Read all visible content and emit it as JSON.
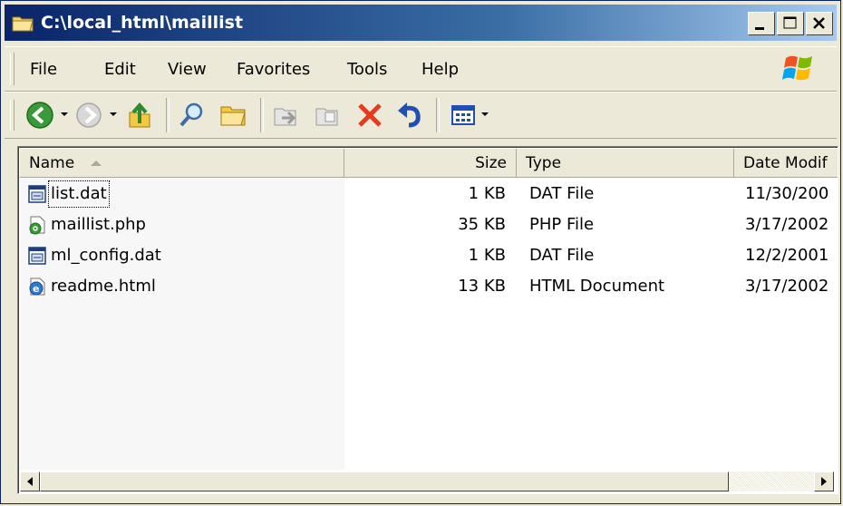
{
  "window": {
    "title": "C:\\local_html\\maillist"
  },
  "menu": [
    "File",
    "Edit",
    "View",
    "Favorites",
    "Tools",
    "Help"
  ],
  "colors": {
    "titlebar_start": "#0a246a",
    "titlebar_end": "#a6caf0",
    "face": "#ece9d8"
  },
  "columns": {
    "name": "Name",
    "size": "Size",
    "type": "Type",
    "date": "Date Modif"
  },
  "files": [
    {
      "name": "list.dat",
      "size": "1 KB",
      "type": "DAT File",
      "date": "11/30/200",
      "icon": "dat-file-icon"
    },
    {
      "name": "maillist.php",
      "size": "35 KB",
      "type": "PHP File",
      "date": "3/17/2002",
      "icon": "php-file-icon"
    },
    {
      "name": "ml_config.dat",
      "size": "1 KB",
      "type": "DAT File",
      "date": "12/2/2001",
      "icon": "dat-file-icon"
    },
    {
      "name": "readme.html",
      "size": "13 KB",
      "type": "HTML Document",
      "date": "3/17/2002",
      "icon": "html-file-icon"
    }
  ],
  "scrollbar": {
    "position": 0
  }
}
